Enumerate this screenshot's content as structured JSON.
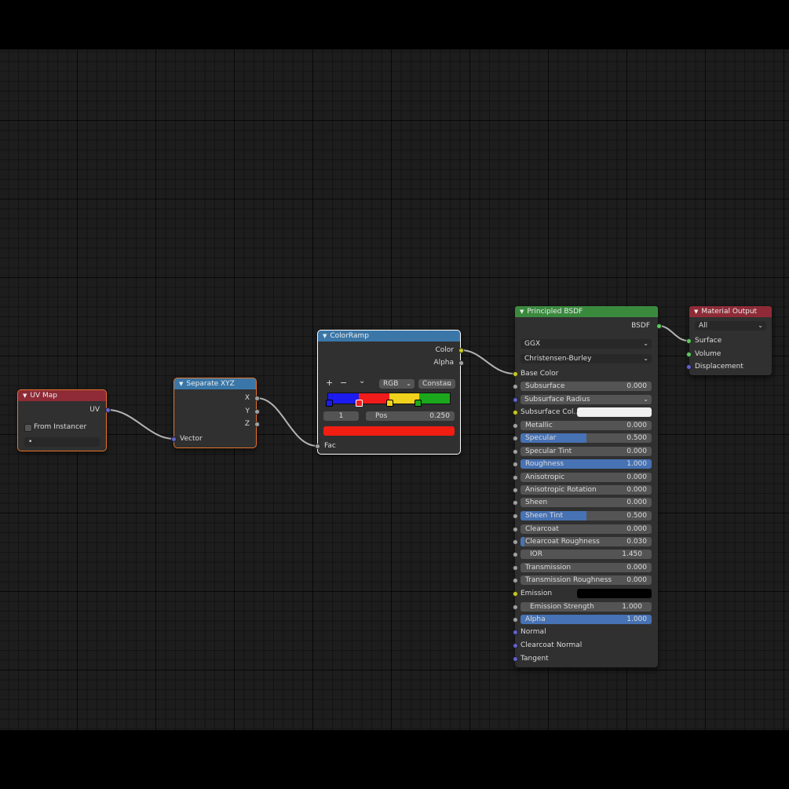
{
  "colors": {
    "socket_color": "#c7c729",
    "socket_shader": "#63c763",
    "socket_vector": "#6363c7",
    "socket_float": "#a1a1a1",
    "header_input": "#8e2b37",
    "header_converter": "#3a77a8",
    "header_shader": "#3a8a3e",
    "selection": "#e8742a",
    "active_selection": "#ffffff",
    "slider_fill": "#4772b3",
    "ramp_blue": "#1c1cf0",
    "ramp_red": "#f01c1c",
    "ramp_yellow": "#f0d21c",
    "ramp_green": "#1ca81c",
    "ramp_preview": "#f21e12",
    "subsurface_color": "#f0f0f0",
    "emission_color": "#000000"
  },
  "uvmap": {
    "title": "UV Map",
    "output_uv": "UV",
    "from_instancer": "From Instancer",
    "from_instancer_checked": false,
    "uv_field_value": "•"
  },
  "separate": {
    "title": "Separate XYZ",
    "out_x": "X",
    "out_y": "Y",
    "out_z": "Z",
    "in_vector": "Vector"
  },
  "colorramp": {
    "title": "ColorRamp",
    "out_color": "Color",
    "out_alpha": "Alpha",
    "add": "+",
    "remove": "−",
    "menu_chevron": "⌄",
    "color_mode": "RGB",
    "interpolation": "Constan",
    "active_index": "1",
    "pos_label": "Pos",
    "pos_value": "0.250",
    "in_fac": "Fac",
    "stops": [
      0.0,
      0.25,
      0.5,
      0.75
    ]
  },
  "bsdf": {
    "title": "Principled BSDF",
    "out_bsdf": "BSDF",
    "distribution": "GGX",
    "subsurface_method": "Christensen-Burley",
    "base_color": "Base Color",
    "subsurface": {
      "label": "Subsurface",
      "value": "0.000",
      "fill": 0.0
    },
    "subsurface_radius": "Subsurface Radius",
    "subsurface_color": "Subsurface Col...",
    "metallic": {
      "label": "Metallic",
      "value": "0.000",
      "fill": 0.0
    },
    "specular": {
      "label": "Specular",
      "value": "0.500",
      "fill": 0.5
    },
    "specular_tint": {
      "label": "Specular Tint",
      "value": "0.000",
      "fill": 0.0
    },
    "roughness": {
      "label": "Roughness",
      "value": "1.000",
      "fill": 1.0
    },
    "anisotropic": {
      "label": "Anisotropic",
      "value": "0.000",
      "fill": 0.0
    },
    "anisotropic_rotation": {
      "label": "Anisotropic Rotation",
      "value": "0.000",
      "fill": 0.0
    },
    "sheen": {
      "label": "Sheen",
      "value": "0.000",
      "fill": 0.0
    },
    "sheen_tint": {
      "label": "Sheen Tint",
      "value": "0.500",
      "fill": 0.5
    },
    "clearcoat": {
      "label": "Clearcoat",
      "value": "0.000",
      "fill": 0.0
    },
    "clearcoat_roughness": {
      "label": "Clearcoat Roughness",
      "value": "0.030",
      "fill": 0.03
    },
    "ior": {
      "label": "IOR",
      "value": "1.450",
      "fill": 0.0
    },
    "transmission": {
      "label": "Transmission",
      "value": "0.000",
      "fill": 0.0
    },
    "transmission_roughness": {
      "label": "Transmission Roughness",
      "value": "0.000",
      "fill": 0.0
    },
    "emission": "Emission",
    "emission_strength": {
      "label": "Emission Strength",
      "value": "1.000",
      "fill": 0.0
    },
    "alpha": {
      "label": "Alpha",
      "value": "1.000",
      "fill": 1.0
    },
    "normal": "Normal",
    "clearcoat_normal": "Clearcoat Normal",
    "tangent": "Tangent"
  },
  "output": {
    "title": "Material Output",
    "target": "All",
    "in_surface": "Surface",
    "in_volume": "Volume",
    "in_displacement": "Displacement"
  }
}
